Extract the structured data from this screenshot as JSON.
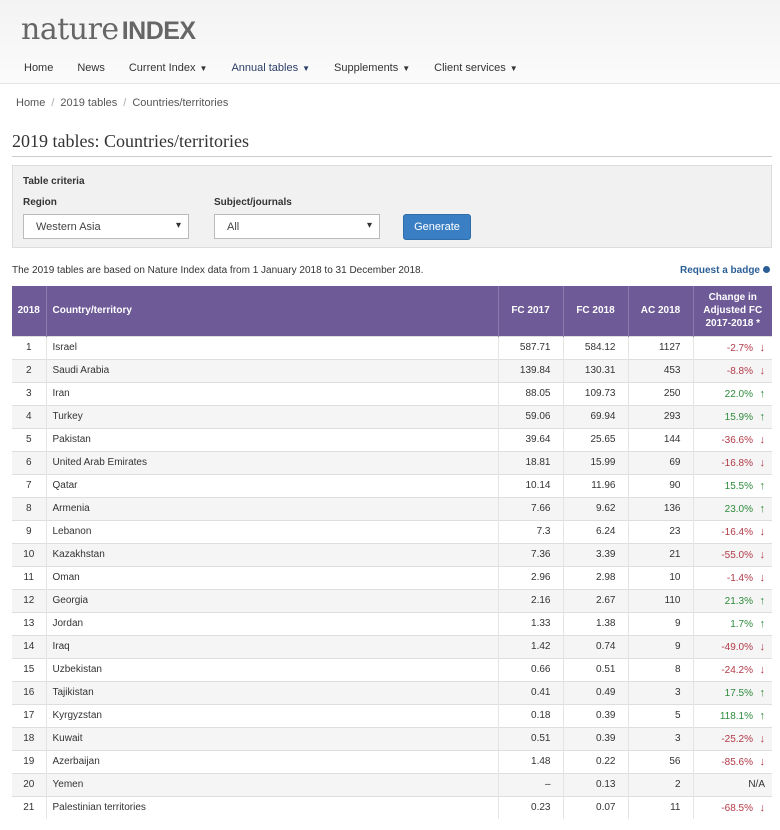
{
  "header": {
    "logo_nature": "nature",
    "logo_index": "INDEX",
    "nav": [
      {
        "label": "Home",
        "caret": false
      },
      {
        "label": "News",
        "caret": false
      },
      {
        "label": "Current Index",
        "caret": true
      },
      {
        "label": "Annual tables",
        "caret": true
      },
      {
        "label": "Supplements",
        "caret": true
      },
      {
        "label": "Client services",
        "caret": true
      }
    ]
  },
  "breadcrumb": [
    "Home",
    "2019 tables",
    "Countries/territories"
  ],
  "page_title": "2019 tables: Countries/territories",
  "criteria": {
    "title": "Table criteria",
    "region_label": "Region",
    "region_value": "Western Asia",
    "subject_label": "Subject/journals",
    "subject_value": "All",
    "generate_label": "Generate"
  },
  "info_text": "The 2019 tables are based on Nature Index data from 1 January 2018 to 31 December 2018.",
  "badge_link": "Request a badge",
  "table": {
    "headers": {
      "rank": "2018",
      "country": "Country/territory",
      "fc2017": "FC 2017",
      "fc2018": "FC 2018",
      "ac2018": "AC 2018",
      "change": "Change in Adjusted FC 2017-2018 *"
    },
    "rows": [
      {
        "rank": "1",
        "country": "Israel",
        "fc2017": "587.71",
        "fc2018": "584.12",
        "ac2018": "1127",
        "change": "-2.7%",
        "dir": "down"
      },
      {
        "rank": "2",
        "country": "Saudi Arabia",
        "fc2017": "139.84",
        "fc2018": "130.31",
        "ac2018": "453",
        "change": "-8.8%",
        "dir": "down"
      },
      {
        "rank": "3",
        "country": "Iran",
        "fc2017": "88.05",
        "fc2018": "109.73",
        "ac2018": "250",
        "change": "22.0%",
        "dir": "up"
      },
      {
        "rank": "4",
        "country": "Turkey",
        "fc2017": "59.06",
        "fc2018": "69.94",
        "ac2018": "293",
        "change": "15.9%",
        "dir": "up"
      },
      {
        "rank": "5",
        "country": "Pakistan",
        "fc2017": "39.64",
        "fc2018": "25.65",
        "ac2018": "144",
        "change": "-36.6%",
        "dir": "down"
      },
      {
        "rank": "6",
        "country": "United Arab Emirates",
        "fc2017": "18.81",
        "fc2018": "15.99",
        "ac2018": "69",
        "change": "-16.8%",
        "dir": "down"
      },
      {
        "rank": "7",
        "country": "Qatar",
        "fc2017": "10.14",
        "fc2018": "11.96",
        "ac2018": "90",
        "change": "15.5%",
        "dir": "up"
      },
      {
        "rank": "8",
        "country": "Armenia",
        "fc2017": "7.66",
        "fc2018": "9.62",
        "ac2018": "136",
        "change": "23.0%",
        "dir": "up"
      },
      {
        "rank": "9",
        "country": "Lebanon",
        "fc2017": "7.3",
        "fc2018": "6.24",
        "ac2018": "23",
        "change": "-16.4%",
        "dir": "down"
      },
      {
        "rank": "10",
        "country": "Kazakhstan",
        "fc2017": "7.36",
        "fc2018": "3.39",
        "ac2018": "21",
        "change": "-55.0%",
        "dir": "down"
      },
      {
        "rank": "11",
        "country": "Oman",
        "fc2017": "2.96",
        "fc2018": "2.98",
        "ac2018": "10",
        "change": "-1.4%",
        "dir": "down"
      },
      {
        "rank": "12",
        "country": "Georgia",
        "fc2017": "2.16",
        "fc2018": "2.67",
        "ac2018": "110",
        "change": "21.3%",
        "dir": "up"
      },
      {
        "rank": "13",
        "country": "Jordan",
        "fc2017": "1.33",
        "fc2018": "1.38",
        "ac2018": "9",
        "change": "1.7%",
        "dir": "up"
      },
      {
        "rank": "14",
        "country": "Iraq",
        "fc2017": "1.42",
        "fc2018": "0.74",
        "ac2018": "9",
        "change": "-49.0%",
        "dir": "down"
      },
      {
        "rank": "15",
        "country": "Uzbekistan",
        "fc2017": "0.66",
        "fc2018": "0.51",
        "ac2018": "8",
        "change": "-24.2%",
        "dir": "down"
      },
      {
        "rank": "16",
        "country": "Tajikistan",
        "fc2017": "0.41",
        "fc2018": "0.49",
        "ac2018": "3",
        "change": "17.5%",
        "dir": "up"
      },
      {
        "rank": "17",
        "country": "Kyrgyzstan",
        "fc2017": "0.18",
        "fc2018": "0.39",
        "ac2018": "5",
        "change": "118.1%",
        "dir": "up"
      },
      {
        "rank": "18",
        "country": "Kuwait",
        "fc2017": "0.51",
        "fc2018": "0.39",
        "ac2018": "3",
        "change": "-25.2%",
        "dir": "down"
      },
      {
        "rank": "19",
        "country": "Azerbaijan",
        "fc2017": "1.48",
        "fc2018": "0.22",
        "ac2018": "56",
        "change": "-85.6%",
        "dir": "down"
      },
      {
        "rank": "20",
        "country": "Yemen",
        "fc2017": "–",
        "fc2018": "0.13",
        "ac2018": "2",
        "change": "N/A",
        "dir": "none"
      },
      {
        "rank": "21",
        "country": "Palestinian territories",
        "fc2017": "0.23",
        "fc2018": "0.07",
        "ac2018": "11",
        "change": "-68.5%",
        "dir": "down"
      }
    ]
  },
  "colors": {
    "header_purple": "#6d5a97",
    "link_blue": "#2b5f96",
    "down_red": "#b23a48",
    "up_green": "#2e8b3c",
    "button_blue": "#3a7fc4"
  }
}
